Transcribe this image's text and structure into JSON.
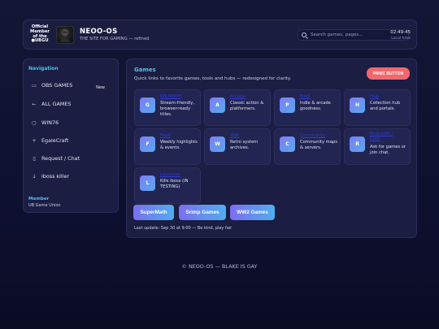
{
  "header": {
    "badge_line1": "Official",
    "badge_line2": "Member",
    "badge_line3": "of the",
    "badge_line4": "UBGU",
    "title": "NEOO-OS",
    "subtitle": "THE SITE FOR GAMING — refined",
    "search_placeholder": "Search games, pages...",
    "time": "02:49:45",
    "time_label": "Local time"
  },
  "sidebar": {
    "title": "Navigation",
    "items": [
      {
        "icon": "window-icon",
        "glyph": "▭",
        "label": "OBS GAMES",
        "badge": "New"
      },
      {
        "icon": "arrow-left-icon",
        "glyph": "←",
        "label": "ALL GAMES"
      },
      {
        "icon": "square-icon",
        "glyph": "▢",
        "label": "WIN76"
      },
      {
        "icon": "plus-icon",
        "glyph": "+",
        "label": "EgaleCraft"
      },
      {
        "icon": "chat-icon",
        "glyph": "▯",
        "label": "Request / Chat"
      },
      {
        "icon": "arrow-down-icon",
        "glyph": "↓",
        "label": "iboss killer"
      }
    ],
    "member_title": "Member",
    "member_value": "UB Game Union"
  },
  "main": {
    "title": "Games",
    "subtitle": "Quick links to favorite games, tools and hubs — redesigned for clarity.",
    "panic_label": "PANIC BUTTON",
    "cards": [
      {
        "letter": "G",
        "link": "GN-MATH",
        "desc": "Stream-friendly, browser-ready titles."
      },
      {
        "letter": "A",
        "link": "Arcade",
        "desc": "Classic action & platformers."
      },
      {
        "letter": "P",
        "link": "Pixel",
        "desc": "Indie & arcade goodness."
      },
      {
        "letter": "H",
        "link": "Hub",
        "desc": "Collection hub and portals."
      },
      {
        "letter": "F",
        "link": "Feed",
        "desc": "Weekly highlights & events."
      },
      {
        "letter": "W",
        "link": "Wiki",
        "desc": "Retro system archives."
      },
      {
        "letter": "C",
        "link": "Community",
        "desc": "Community maps & servers."
      },
      {
        "letter": "R",
        "link": "Requests / Chat",
        "desc": "Ask for games or join chat."
      },
      {
        "letter": "L",
        "link": "Launcher",
        "desc": "Kills iboss (IN TESTING)"
      }
    ],
    "quick_buttons": [
      "SuperMath",
      "Srimp Games",
      "WW2 Games"
    ],
    "last_update": "Last update: Sep 30 at 9:00 — Be kind, play fair"
  },
  "footer": {
    "text": "© NEOO-OS — BLAKE IS GAY"
  },
  "colors": {
    "accent": "#4fc3e8",
    "panic": "#f0686c",
    "link": "#2f3bd6",
    "background": "#131634"
  }
}
